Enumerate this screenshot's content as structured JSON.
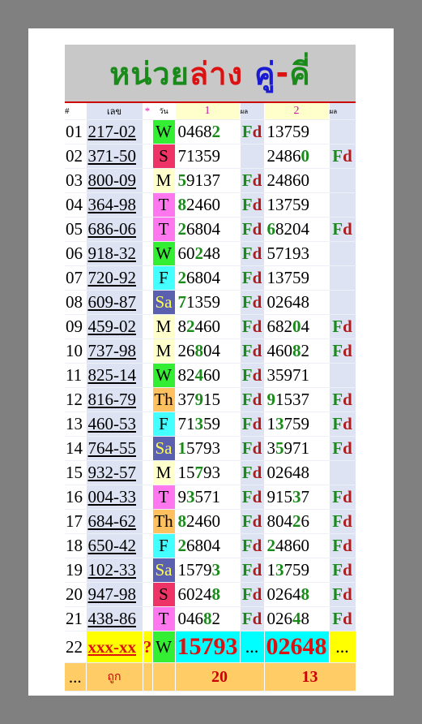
{
  "banner": {
    "title_part1": "หน่วย",
    "title_part2": "ล่าง",
    "title_part3": "คู่",
    "title_dash": "-",
    "title_part4": "คี่"
  },
  "header": {
    "idx": "#",
    "code": "เลข",
    "star": "*",
    "day": "วัน",
    "col1": "1",
    "result1": "ผล",
    "col2": "2",
    "result2": "ผล"
  },
  "colors": {
    "banner_bg": "#c8c8c8",
    "green": "#1a8a1a",
    "red": "#dd1111",
    "blue": "#1a1ad0",
    "col_bg": "#dde3f3",
    "yellow": "#ffff00",
    "cyan": "#00ffff",
    "orange": "#ffcc66"
  },
  "rows": [
    {
      "idx": "01",
      "code": "217-02",
      "day": "W",
      "n1": "04682",
      "h1": [
        4
      ],
      "f1": "Fd",
      "n2": "13759",
      "h2": [],
      "f2": ""
    },
    {
      "idx": "02",
      "code": "371-50",
      "day": "S",
      "n1": "71359",
      "h1": [],
      "f1": "",
      "n2": "24860",
      "h2": [
        4
      ],
      "f2": "Fd"
    },
    {
      "idx": "03",
      "code": "800-09",
      "day": "M",
      "n1": "59137",
      "h1": [
        0
      ],
      "f1": "Fd",
      "n2": "24860",
      "h2": [],
      "f2": ""
    },
    {
      "idx": "04",
      "code": "364-98",
      "day": "T",
      "n1": "82460",
      "h1": [
        0
      ],
      "f1": "Fd",
      "n2": "13759",
      "h2": [],
      "f2": ""
    },
    {
      "idx": "05",
      "code": "686-06",
      "day": "T",
      "n1": "26804",
      "h1": [
        0
      ],
      "f1": "Fd",
      "n2": "68204",
      "h2": [
        0
      ],
      "f2": "Fd"
    },
    {
      "idx": "06",
      "code": "918-32",
      "day": "W",
      "n1": "60248",
      "h1": [
        2
      ],
      "f1": "Fd",
      "n2": "57193",
      "h2": [],
      "f2": ""
    },
    {
      "idx": "07",
      "code": "720-92",
      "day": "F",
      "n1": "26804",
      "h1": [
        0
      ],
      "f1": "Fd",
      "n2": "13759",
      "h2": [],
      "f2": ""
    },
    {
      "idx": "08",
      "code": "609-87",
      "day": "Sa",
      "n1": "71359",
      "h1": [
        0
      ],
      "f1": "Fd",
      "n2": "02648",
      "h2": [],
      "f2": ""
    },
    {
      "idx": "09",
      "code": "459-02",
      "day": "M",
      "n1": "82460",
      "h1": [
        1
      ],
      "f1": "Fd",
      "n2": "68204",
      "h2": [
        3
      ],
      "f2": "Fd"
    },
    {
      "idx": "10",
      "code": "737-98",
      "day": "M",
      "n1": "26804",
      "h1": [
        2
      ],
      "f1": "Fd",
      "n2": "46082",
      "h2": [
        3
      ],
      "f2": "Fd"
    },
    {
      "idx": "11",
      "code": "825-14",
      "day": "W",
      "n1": "82460",
      "h1": [
        2
      ],
      "f1": "Fd",
      "n2": "35971",
      "h2": [],
      "f2": ""
    },
    {
      "idx": "12",
      "code": "816-79",
      "day": "Th",
      "n1": "37915",
      "h1": [
        2
      ],
      "f1": "Fd",
      "n2": "91537",
      "h2": [
        0
      ],
      "f2": "Fd"
    },
    {
      "idx": "13",
      "code": "460-53",
      "day": "F",
      "n1": "71359",
      "h1": [
        2
      ],
      "f1": "Fd",
      "n2": "13759",
      "h2": [
        1
      ],
      "f2": "Fd"
    },
    {
      "idx": "14",
      "code": "764-55",
      "day": "Sa",
      "n1": "15793",
      "h1": [
        0
      ],
      "f1": "Fd",
      "n2": "35971",
      "h2": [
        1
      ],
      "f2": "Fd"
    },
    {
      "idx": "15",
      "code": "932-57",
      "day": "M",
      "n1": "15793",
      "h1": [
        2
      ],
      "f1": "Fd",
      "n2": "02648",
      "h2": [],
      "f2": ""
    },
    {
      "idx": "16",
      "code": "004-33",
      "day": "T",
      "n1": "93571",
      "h1": [
        1
      ],
      "f1": "Fd",
      "n2": "91537",
      "h2": [
        3
      ],
      "f2": "Fd"
    },
    {
      "idx": "17",
      "code": "684-62",
      "day": "Th",
      "n1": "82460",
      "h1": [
        0
      ],
      "f1": "Fd",
      "n2": "80426",
      "h2": [
        3
      ],
      "f2": "Fd"
    },
    {
      "idx": "18",
      "code": "650-42",
      "day": "F",
      "n1": "26804",
      "h1": [
        0
      ],
      "f1": "Fd",
      "n2": "24860",
      "h2": [
        0
      ],
      "f2": "Fd"
    },
    {
      "idx": "19",
      "code": "102-33",
      "day": "Sa",
      "n1": "15793",
      "h1": [
        4
      ],
      "f1": "Fd",
      "n2": "13759",
      "h2": [
        1
      ],
      "f2": "Fd"
    },
    {
      "idx": "20",
      "code": "947-98",
      "day": "S",
      "n1": "60248",
      "h1": [
        4
      ],
      "f1": "Fd",
      "n2": "02648",
      "h2": [
        4
      ],
      "f2": "Fd"
    },
    {
      "idx": "21",
      "code": "438-86",
      "day": "T",
      "n1": "04682",
      "h1": [
        3
      ],
      "f1": "Fd",
      "n2": "02648",
      "h2": [
        3
      ],
      "f2": "Fd"
    }
  ],
  "prediction": {
    "idx": "22",
    "code": "xxx-xx",
    "mark": "?",
    "day": "W",
    "n1": "15793",
    "f1": "...",
    "n2": "02648",
    "f2": "..."
  },
  "totals": {
    "idx": "...",
    "label": "ถูก",
    "sum1": "20",
    "sum2": "13"
  }
}
